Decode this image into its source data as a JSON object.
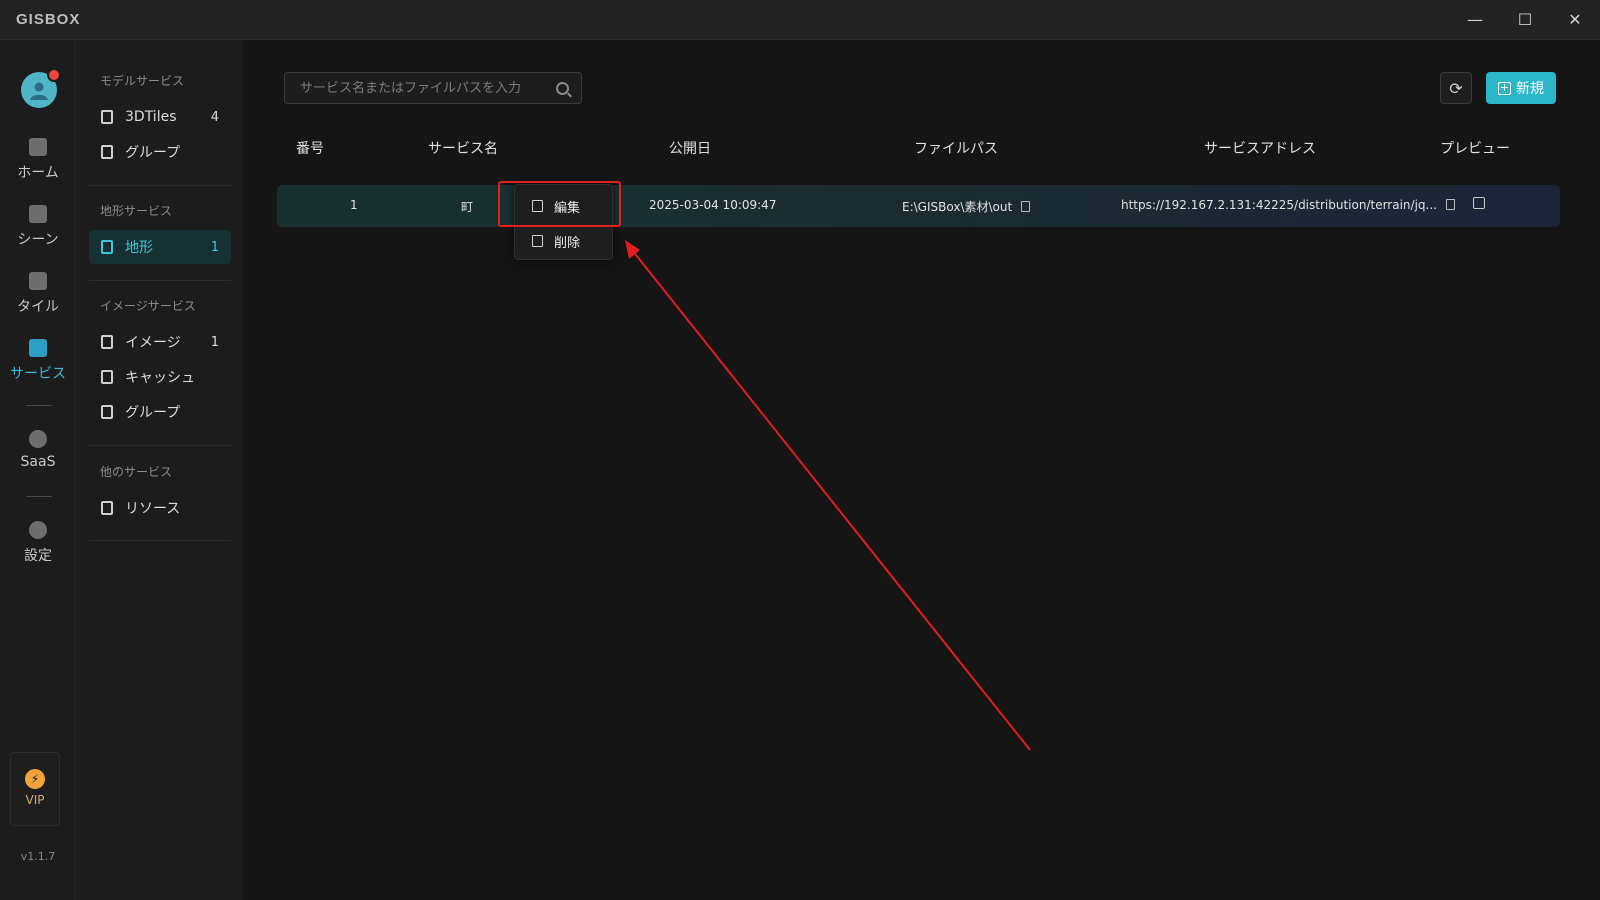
{
  "app": {
    "logo": "GISBOX",
    "window_controls": {
      "minimize": "—",
      "maximize": "☐",
      "close": "✕"
    }
  },
  "rail": {
    "items": [
      {
        "label": "ホーム",
        "icon": "home-icon"
      },
      {
        "label": "シーン",
        "icon": "scene-icon"
      },
      {
        "label": "タイル",
        "icon": "tile-icon"
      },
      {
        "label": "サービス",
        "icon": "service-icon",
        "active": true
      },
      {
        "label": "SaaS",
        "icon": "lock-icon"
      },
      {
        "label": "設定",
        "icon": "settings-icon"
      }
    ],
    "vip": {
      "label": "VIP",
      "icon": "lightning-icon"
    },
    "version": "v1.1.7"
  },
  "sidebar": {
    "groups": [
      {
        "title": "モデルサービス",
        "items": [
          {
            "label": "3DTiles",
            "count": "4"
          },
          {
            "label": "グループ",
            "count": ""
          }
        ]
      },
      {
        "title": "地形サービス",
        "items": [
          {
            "label": "地形",
            "count": "1",
            "active": true
          }
        ]
      },
      {
        "title": "イメージサービス",
        "items": [
          {
            "label": "イメージ",
            "count": "1"
          },
          {
            "label": "キャッシュ",
            "count": ""
          },
          {
            "label": "グループ",
            "count": ""
          }
        ]
      },
      {
        "title": "他のサービス",
        "items": [
          {
            "label": "リソース",
            "count": ""
          }
        ]
      }
    ]
  },
  "toolbar": {
    "search_placeholder": "サービス名またはファイルパスを入力",
    "refresh_icon": "⟳",
    "new_label": "新規",
    "new_icon": "+"
  },
  "table": {
    "columns": [
      "番号",
      "サービス名",
      "公開日",
      "ファイルパス",
      "サービスアドレス",
      "プレビュー"
    ],
    "rows": [
      {
        "number": "1",
        "name": "町",
        "date": "2025-03-04 10:09:47",
        "path": "E:\\GISBox\\素材\\out",
        "address": "https://192.167.2.131:42225/distribution/terrain/jq..."
      }
    ]
  },
  "context_menu": {
    "items": [
      {
        "label": "編集",
        "icon": "edit-icon"
      },
      {
        "label": "削除",
        "icon": "trash-icon"
      }
    ]
  },
  "colors": {
    "accent": "#2bb7c9",
    "annotation": "#e01f1f"
  }
}
